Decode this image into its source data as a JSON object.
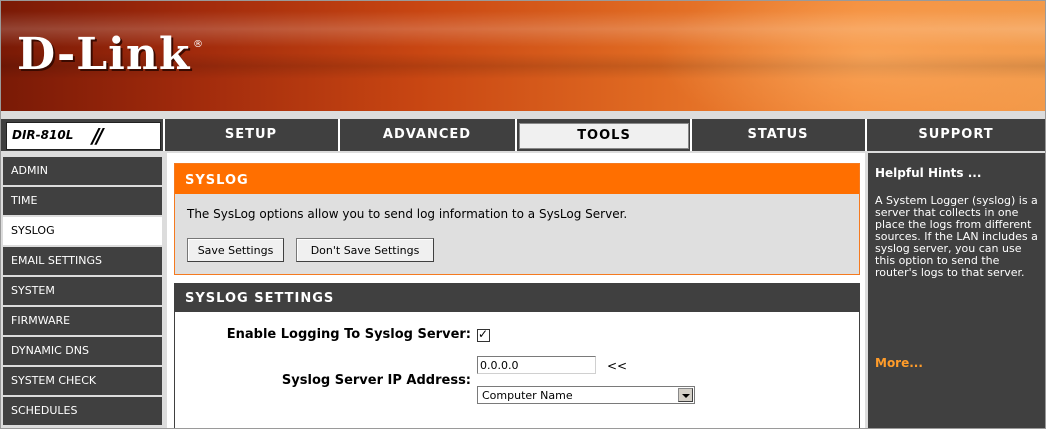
{
  "brand": {
    "logo_text": "D-Link",
    "registered": "®",
    "model": "DIR-810L"
  },
  "nav": {
    "tabs": [
      {
        "label": "SETUP"
      },
      {
        "label": "ADVANCED"
      },
      {
        "label": "TOOLS",
        "active": true
      },
      {
        "label": "STATUS"
      },
      {
        "label": "SUPPORT"
      }
    ]
  },
  "sidebar": {
    "items": [
      {
        "label": "ADMIN"
      },
      {
        "label": "TIME"
      },
      {
        "label": "SYSLOG",
        "active": true
      },
      {
        "label": "EMAIL SETTINGS"
      },
      {
        "label": "SYSTEM"
      },
      {
        "label": "FIRMWARE"
      },
      {
        "label": "DYNAMIC DNS"
      },
      {
        "label": "SYSTEM CHECK"
      },
      {
        "label": "SCHEDULES"
      }
    ]
  },
  "syslog": {
    "title": "SYSLOG",
    "description": "The SysLog options allow you to send log information to a SysLog Server.",
    "save_label": "Save Settings",
    "dont_save_label": "Don't Save Settings"
  },
  "settings": {
    "title": "SYSLOG SETTINGS",
    "enable_label": "Enable Logging To Syslog Server:",
    "enable_checked": true,
    "ip_label": "Syslog Server IP Address:",
    "ip_value": "0.0.0.0",
    "arrows": "<<",
    "computer_select_value": "Computer Name"
  },
  "hints": {
    "title": "Helpful Hints ...",
    "body": "A System Logger (syslog) is a server that collects in one place the logs from different sources. If the LAN includes a syslog server, you can use this option to send the router's logs to that server.",
    "more": "More..."
  },
  "colors": {
    "accent": "#ff6f00",
    "nav_bg": "#404040",
    "more_link": "#ff9c2a"
  }
}
